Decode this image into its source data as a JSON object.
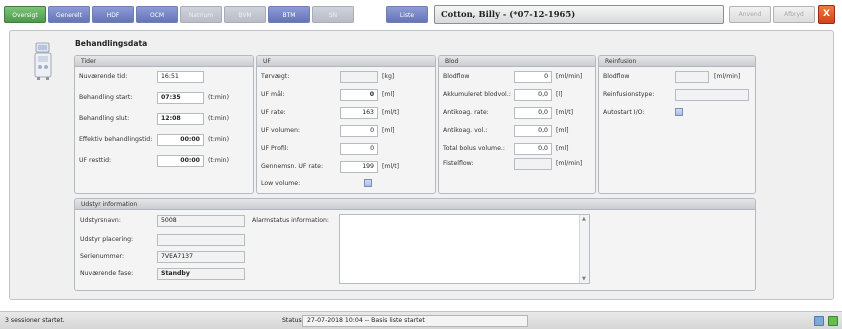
{
  "tabs": [
    {
      "label": "Oversigt",
      "state": "active"
    },
    {
      "label": "Generelt",
      "state": "normal"
    },
    {
      "label": "HDF",
      "state": "normal"
    },
    {
      "label": "OCM",
      "state": "normal"
    },
    {
      "label": "Natrium",
      "state": "disabled"
    },
    {
      "label": "BVM",
      "state": "disabled"
    },
    {
      "label": "BTM",
      "state": "normal"
    },
    {
      "label": "SN",
      "state": "disabled"
    },
    {
      "label": "Liste",
      "state": "normal"
    }
  ],
  "patient": "Cotton, Billy - (*07-12-1965)",
  "actions": {
    "apply": "Anvend",
    "cancel": "Afbryd",
    "close": "X"
  },
  "page_title": "Behandlingsdata",
  "tider": {
    "header": "Tider",
    "rows": [
      {
        "label": "Nuværende tid:",
        "value": "16:51",
        "unit": ""
      },
      {
        "label": "Behandling start:",
        "value": "07:35",
        "unit": "(t:min)"
      },
      {
        "label": "Behandling slut:",
        "value": "12:08",
        "unit": "(t:min)"
      },
      {
        "label": "Effektiv behandlingstid:",
        "value": "00:00",
        "unit": "(t:min)"
      },
      {
        "label": "UF resttid:",
        "value": "00:00",
        "unit": "(t:min)"
      }
    ]
  },
  "uf": {
    "header": "UF",
    "rows": [
      {
        "label": "Tørvægt:",
        "value": "",
        "unit": "[kg]"
      },
      {
        "label": "UF mål:",
        "value": "0",
        "unit": "[ml]"
      },
      {
        "label": "UF rate:",
        "value": "163",
        "unit": "[ml/t]"
      },
      {
        "label": "UF volumen:",
        "value": "0",
        "unit": "[ml]"
      },
      {
        "label": "UF Profil:",
        "value": "0",
        "unit": ""
      },
      {
        "label": "Gennemsn. UF rate:",
        "value": "199",
        "unit": "[ml/t]"
      }
    ],
    "low_volume_label": "Low volume:"
  },
  "blod": {
    "header": "Blod",
    "rows": [
      {
        "label": "Blodflow",
        "value": "0",
        "unit": "[ml/min]"
      },
      {
        "label": "Akkumuleret blodvol.:",
        "value": "0,0",
        "unit": "[l]"
      },
      {
        "label": "Antikoag. rate:",
        "value": "0,0",
        "unit": "[ml/t]"
      },
      {
        "label": "Antikoag. vol.:",
        "value": "0,0",
        "unit": "[ml]"
      },
      {
        "label": "Total bolus volume.:",
        "value": "0,0",
        "unit": "[ml]"
      },
      {
        "label": "Fistelflow:",
        "value": "",
        "unit": "[ml/min]"
      }
    ]
  },
  "reinfusion": {
    "header": "Reinfusion",
    "blodflow_label": "Blodflow",
    "blodflow_value": "",
    "blodflow_unit": "[ml/min]",
    "type_label": "Reinfusionstype:",
    "type_value": "",
    "autostart_label": "Autostart I/O:"
  },
  "udstyr": {
    "header": "Udstyr information",
    "rows": [
      {
        "label": "Udstyrsnavn:",
        "value": "5008"
      },
      {
        "label": "Udstyr placering:",
        "value": ""
      },
      {
        "label": "Serienummer:",
        "value": "7VEA7137"
      },
      {
        "label": "Nuværende fase:",
        "value": "Standby"
      }
    ],
    "alarm_label": "Alarmstatus information:",
    "alarm_text": ""
  },
  "statusbar": {
    "left_message": "3 sessioner startet.",
    "status_label": "Status:",
    "status_text": "27-07-2018 10:04 -- Basis liste startet"
  },
  "colors": {
    "active_tab": "#4c9a49",
    "tab": "#6674b8",
    "close": "#d0441a"
  }
}
